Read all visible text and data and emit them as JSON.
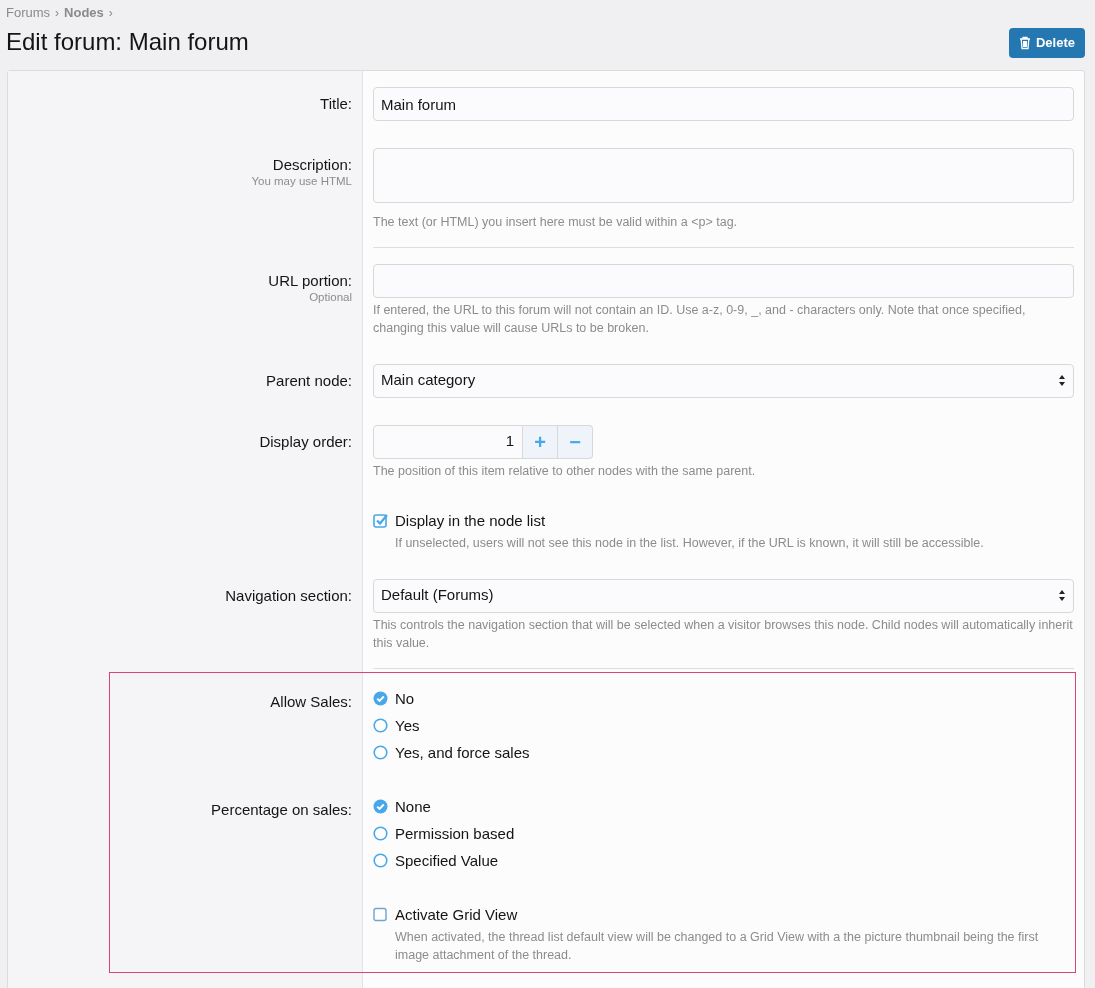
{
  "breadcrumb": {
    "separator": "›",
    "items": [
      {
        "label": "Forums",
        "bold": false
      },
      {
        "label": "Nodes",
        "bold": true
      }
    ]
  },
  "title": "Edit forum: Main forum",
  "delete_button": "Delete",
  "rows": [
    {
      "kind": "text",
      "label": "Title:",
      "value": "Main forum",
      "divider_after": false,
      "highlighted": false
    },
    {
      "kind": "textarea",
      "label": "Description:",
      "sublabel": "You may use HTML",
      "hint": "The text (or HTML) you insert here must be valid within a <p> tag.",
      "divider_after": true,
      "highlighted": false
    },
    {
      "kind": "text",
      "label": "URL portion:",
      "sublabel": "Optional",
      "hint": "If entered, the URL to this forum will not contain an ID. Use a-z, 0-9, _, and - characters only. Note that once specified, changing this value will cause URLs to be broken.",
      "divider_after": false,
      "highlighted": false
    },
    {
      "kind": "select",
      "label": "Parent node:",
      "value": "Main category",
      "divider_after": false,
      "highlighted": false
    },
    {
      "kind": "spinner",
      "label": "Display order:",
      "value": "1",
      "plus": "+",
      "minus": "−",
      "hint": "The position of this item relative to other nodes with the same parent.",
      "divider_after": false,
      "highlighted": false
    },
    {
      "kind": "checkbox",
      "option": "Display in the node list",
      "checked": true,
      "hint": "If unselected, users will not see this node in the list. However, if the URL is known, it will still be accessible.",
      "divider_after": false,
      "highlighted": false
    },
    {
      "kind": "select",
      "label": "Navigation section:",
      "value": "Default (Forums)",
      "hint": "This controls the navigation section that will be selected when a visitor browses this node. Child nodes will automatically inherit this value.",
      "divider_after": true,
      "highlighted": false
    },
    {
      "kind": "radio",
      "label": "Allow Sales:",
      "options": [
        {
          "label": "No",
          "selected": true
        },
        {
          "label": "Yes",
          "selected": false
        },
        {
          "label": "Yes, and force sales",
          "selected": false
        }
      ],
      "divider_after": false,
      "highlighted": true
    },
    {
      "kind": "radio",
      "label": "Percentage on sales:",
      "options": [
        {
          "label": "None",
          "selected": true
        },
        {
          "label": "Permission based",
          "selected": false
        },
        {
          "label": "Specified Value",
          "selected": false
        }
      ],
      "divider_after": false,
      "highlighted": true
    },
    {
      "kind": "checkbox",
      "option": "Activate Grid View",
      "checked": false,
      "hint": "When activated, the thread list default view will be changed to a Grid View with a the picture thumbnail being the first image attachment of the thread.",
      "divider_after": false,
      "highlighted": true
    }
  ]
}
